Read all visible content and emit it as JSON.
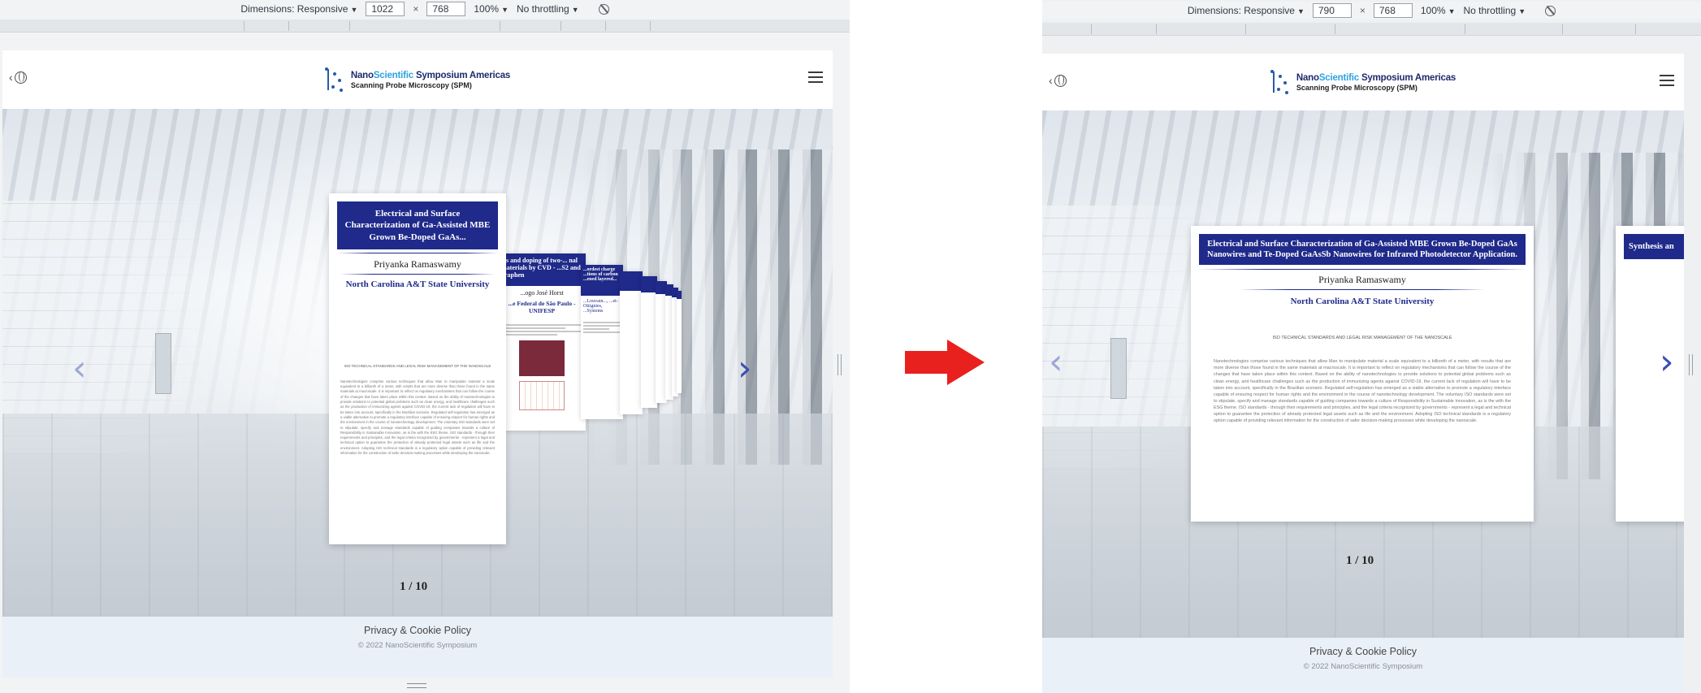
{
  "devtools": {
    "dimensions_label": "Dimensions: Responsive",
    "times": "×",
    "zoom": "100%",
    "throttling": "No throttling",
    "left": {
      "width": "1022",
      "height": "768"
    },
    "right": {
      "width": "790",
      "height": "768"
    }
  },
  "site": {
    "logo_nano": "Nano",
    "logo_scientific": "Scientific",
    "logo_rest": " Symposium Americas",
    "logo_sub": "Scanning Probe Microscopy (SPM)",
    "footer_privacy": "Privacy & Cookie Policy",
    "footer_copy": "© 2022 NanoScientific Symposium"
  },
  "carousel": {
    "counter": "1 / 10",
    "current": {
      "title_short": "Electrical and Surface Characterization of Ga-Assisted MBE Grown Be-Doped GaAs...",
      "title_full": "Electrical and Surface Characterization of Ga-Assisted MBE Grown Be-Doped GaAs Nanowires and Te-Doped GaAsSb Nanowires for Infrared Photodetector Application.",
      "author": "Priyanka Ramaswamy",
      "institution": "North Carolina A&T State University",
      "subheading": "ISO TECHNICAL STANDARDS AND LEGAL RISK MANAGEMENT OF THE NANOSCALE",
      "body": "Nanotechnologies comprise various techniques that allow Man to manipulate material a scale equivalent to a billionth of a meter, with results that are more diverse than those found in the same materials at macroscale. It is important to reflect on regulatory mechanisms that can follow the course of the changes that have taken place within this context. Based on the ability of nanotechnologies to provide solutions to potential global problems such as clean energy, and healthcare challenges such as the production of immunizing agents against COVID-19, the current lack of regulation will have to be taken into account, specifically in the Brazilian scenario. Regulated self-regulation has emerged as a viable alternative to promote a regulatory interface capable of ensuring respect for human rights and the environment in the course of nanotechnology development. The voluntary ISO standards were set to stipulate, specify and manage standards capable of guiding companies towards a culture of Responsibility in Sustainable Innovation, as is the with the ESG theme. ISO standards - through their requirements and principles, and the legal criteria recognized by governments - represent a legal and technical option to guarantee the protection of already protected legal assets such as life and the environment. Adopting ISO technical standards is a regulatory option capable of providing relevant information for the construction of safer decision-making processes while developing the nanoscale."
    },
    "next": {
      "title_fragment": "...s and doping of two-... nal materials by CVD - ...S2 and graphen",
      "author_fragment": "...ogo José Horst",
      "institution_fragment": "...e Federal de São Paulo - UNIFESP",
      "right_title": "Synthesis an"
    },
    "third": {
      "title_fragment": "...ordest charge ...tions of carbon ...ened layered...",
      "inst_fragment": "...Louvain..., ...et-Ottignies, ...Systems"
    }
  }
}
